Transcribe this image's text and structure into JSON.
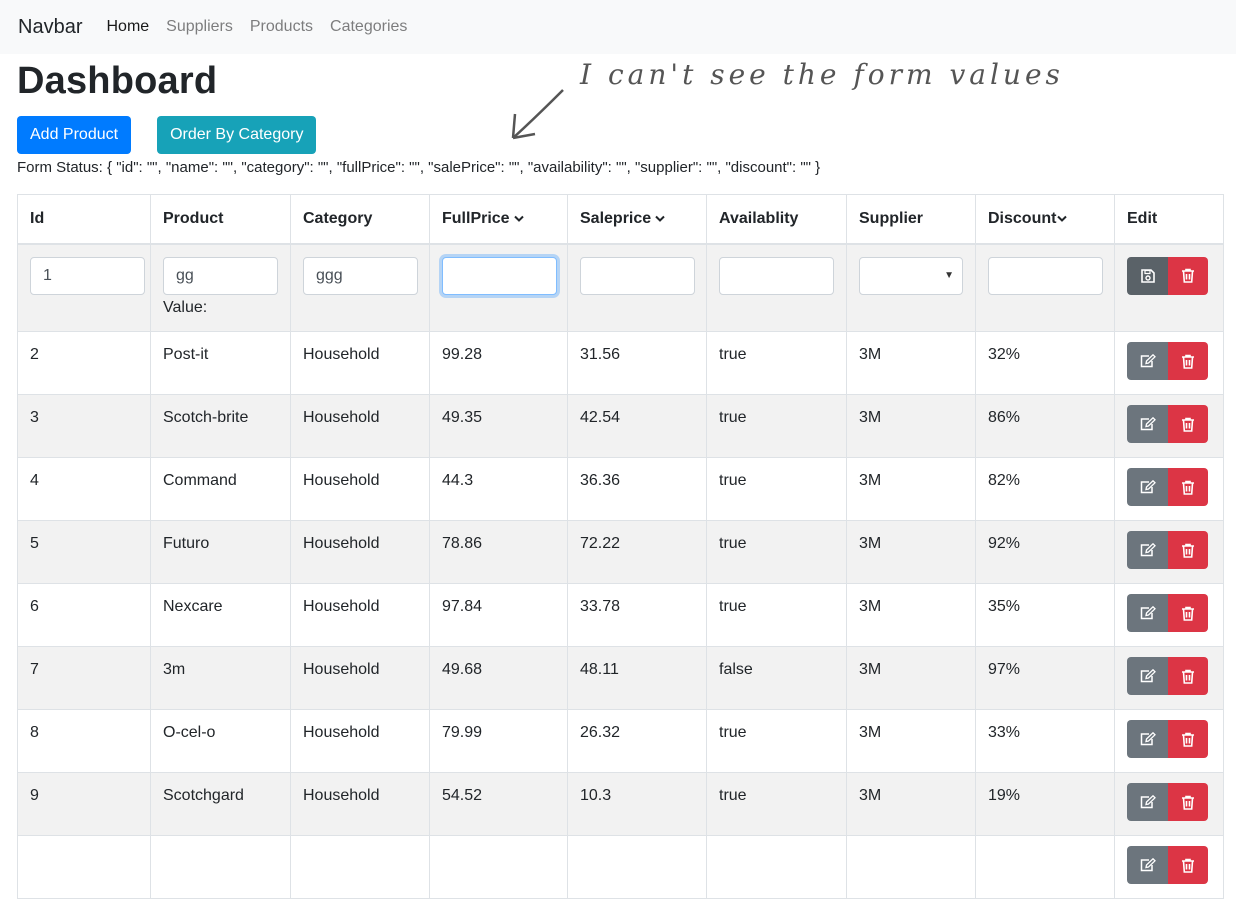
{
  "navbar": {
    "brand": "Navbar",
    "links": [
      "Home",
      "Suppliers",
      "Products",
      "Categories"
    ]
  },
  "page": {
    "title": "Dashboard",
    "add_product_label": "Add Product",
    "order_by_category_label": "Order By Category",
    "form_status": "Form Status: { \"id\": \"\", \"name\": \"\", \"category\": \"\", \"fullPrice\": \"\", \"salePrice\": \"\", \"availability\": \"\", \"supplier\": \"\", \"discount\": \"\" }",
    "annotation": "I can't see the form values"
  },
  "table": {
    "headers": [
      "Id",
      "Product",
      "Category",
      "FullPrice",
      "Saleprice",
      "Availablity",
      "Supplier",
      "Discount",
      "Edit"
    ],
    "form_row": {
      "id": "1",
      "name": "gg",
      "category": "ggg",
      "fullPrice": "",
      "salePrice": "",
      "availability": "",
      "supplier": "",
      "discount": "",
      "value_label": "Value:"
    },
    "rows": [
      [
        "2",
        "Post-it",
        "Household",
        "99.28",
        "31.56",
        "true",
        "3M",
        "32%"
      ],
      [
        "3",
        "Scotch-brite",
        "Household",
        "49.35",
        "42.54",
        "true",
        "3M",
        "86%"
      ],
      [
        "4",
        "Command",
        "Household",
        "44.3",
        "36.36",
        "true",
        "3M",
        "82%"
      ],
      [
        "5",
        "Futuro",
        "Household",
        "78.86",
        "72.22",
        "true",
        "3M",
        "92%"
      ],
      [
        "6",
        "Nexcare",
        "Household",
        "97.84",
        "33.78",
        "true",
        "3M",
        "35%"
      ],
      [
        "7",
        "3m",
        "Household",
        "49.68",
        "48.11",
        "false",
        "3M",
        "97%"
      ],
      [
        "8",
        "O-cel-o",
        "Household",
        "79.99",
        "26.32",
        "true",
        "3M",
        "33%"
      ],
      [
        "9",
        "Scotchgard",
        "Household",
        "54.52",
        "10.3",
        "true",
        "3M",
        "19%"
      ],
      [
        "",
        "",
        "",
        "",
        "",
        "",
        "",
        ""
      ]
    ]
  },
  "colors": {
    "primary": "#007bff",
    "info": "#17a2b8",
    "secondary": "#6c757d",
    "danger": "#dc3545"
  },
  "icons": {
    "save": "save-icon",
    "edit": "edit-icon",
    "delete": "trash-icon",
    "sort": "chevron-down-icon"
  }
}
